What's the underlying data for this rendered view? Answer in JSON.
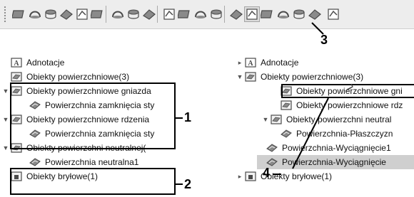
{
  "toolbar": {
    "icons": [
      "surface-sheet-icon",
      "revolve-surface-icon",
      "loft-surface-icon",
      "sweep-surface-icon",
      "extrude-surface-icon",
      "boundary-surface-icon",
      "fill-surface-icon",
      "freeform-icon",
      "offset-surface-icon",
      "ruled-surface-icon",
      "planar-surface-icon",
      "untrim-icon",
      "knit-surface-icon",
      "thicken-icon",
      "neutral-surface-icon",
      "extend-surface-icon",
      "trim-surface-icon",
      "delete-face-icon",
      "replace-face-icon",
      "mid-surface-icon"
    ],
    "pressed_icon": "neutral-surface-icon"
  },
  "left_tree": {
    "rows": [
      {
        "label": "Adnotacje",
        "icon": "annotations-icon",
        "chevron": ""
      },
      {
        "label": "Obiekty powierzchniowe(3)",
        "icon": "surface-bodies-folder-icon",
        "chevron": ""
      },
      {
        "label": "Obiekty powierzchniowe gniazda",
        "icon": "surface-bodies-folder-icon",
        "chevron": "▼"
      },
      {
        "label": "Powierzchnia zamknięcia sty",
        "icon": "surface-feature-icon",
        "chevron": ""
      },
      {
        "label": "Obiekty powierzchniowe rdzenia",
        "icon": "surface-bodies-folder-icon",
        "chevron": "▼"
      },
      {
        "label": "Powierzchnia zamknięcia sty",
        "icon": "surface-feature-icon",
        "chevron": ""
      },
      {
        "label": "Obiekty powierzchni neutralnej(",
        "icon": "surface-bodies-folder-icon",
        "chevron": "▼"
      },
      {
        "label": "Powierzchnia neutralna1",
        "icon": "surface-feature-icon",
        "chevron": ""
      },
      {
        "label": "Obiekty bryłowe(1)",
        "icon": "solid-bodies-folder-icon",
        "chevron": ""
      }
    ]
  },
  "right_tree": {
    "rows": [
      {
        "label": "Adnotacje",
        "icon": "annotations-icon",
        "chevron": "▸"
      },
      {
        "label": "Obiekty powierzchniowe(3)",
        "icon": "surface-bodies-folder-icon",
        "chevron": "▼"
      },
      {
        "label": "Obiekty powierzchniowe gni",
        "icon": "surface-bodies-folder-icon",
        "chevron": "",
        "boxed": true
      },
      {
        "label": "Obiekty powierzchniowe rdz",
        "icon": "surface-bodies-folder-icon",
        "chevron": ""
      },
      {
        "label": "Obiekty powierzchni neutral",
        "icon": "surface-bodies-folder-icon",
        "chevron": "▼"
      },
      {
        "label": "Powierzchnia-Płaszczyzn",
        "icon": "surface-feature-icon",
        "chevron": ""
      },
      {
        "label": "Powierzchnia-Wyciągnięcie1",
        "icon": "surface-feature-icon",
        "chevron": ""
      },
      {
        "label": "Powierzchnia-Wyciągnięcie",
        "icon": "surface-feature-icon",
        "chevron": "",
        "selected": true
      },
      {
        "label": "Obiekty bryłowe(1)",
        "icon": "solid-bodies-folder-icon",
        "chevron": "▸"
      }
    ]
  },
  "callouts": {
    "one": "1",
    "two": "2",
    "three": "3",
    "four": "4"
  },
  "colors": {
    "callout": "#000000",
    "selection": "#cfcfcf",
    "icon_dark": "#4a4a4a",
    "icon_mid": "#8a8a8a"
  }
}
